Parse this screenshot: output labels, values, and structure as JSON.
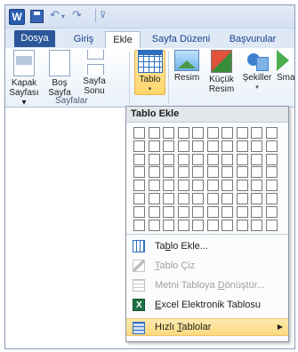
{
  "qat": {
    "app_letter": "W",
    "undo_glyph": "↶",
    "redo_glyph": "↷",
    "dropdown_glyph": "▾",
    "customize_glyph": "⊽"
  },
  "tabs": [
    {
      "label": "Dosya"
    },
    {
      "label": "Giriş"
    },
    {
      "label": "Ekle"
    },
    {
      "label": "Sayfa Düzeni"
    },
    {
      "label": "Başvurular"
    }
  ],
  "ribbon": {
    "cover": {
      "line1": "Kapak",
      "line2": "Sayfası ▾"
    },
    "blank": {
      "line1": "Boş",
      "line2": "Sayfa"
    },
    "break": {
      "line1": "Sayfa",
      "line2": "Sonu"
    },
    "table": {
      "line1": "Tablo",
      "line2": "▾"
    },
    "picture": {
      "line1": "Resim"
    },
    "clipart": {
      "line1": "Küçük",
      "line2": "Resim"
    },
    "shapes": {
      "line1": "Şekiller",
      "line2": "▾"
    },
    "smartart": {
      "line1": "Smar"
    },
    "group_pages": "Sayfalar"
  },
  "dropdown": {
    "header": "Tablo Ekle",
    "grid": {
      "columns": 10,
      "rows": 8
    },
    "items": [
      {
        "pre": "Ta",
        "key": "b",
        "post": "lo Ekle..."
      },
      {
        "pre": "",
        "key": "T",
        "post": "ablo Çiz"
      },
      {
        "pre": "Metni Tabloya ",
        "key": "D",
        "post": "önüştür..."
      },
      {
        "pre": "",
        "key": "E",
        "post": "xcel Elektronik Tablosu"
      },
      {
        "pre": "Hızlı ",
        "key": "T",
        "post": "ablolar"
      }
    ],
    "submenu_arrow": "▶"
  }
}
